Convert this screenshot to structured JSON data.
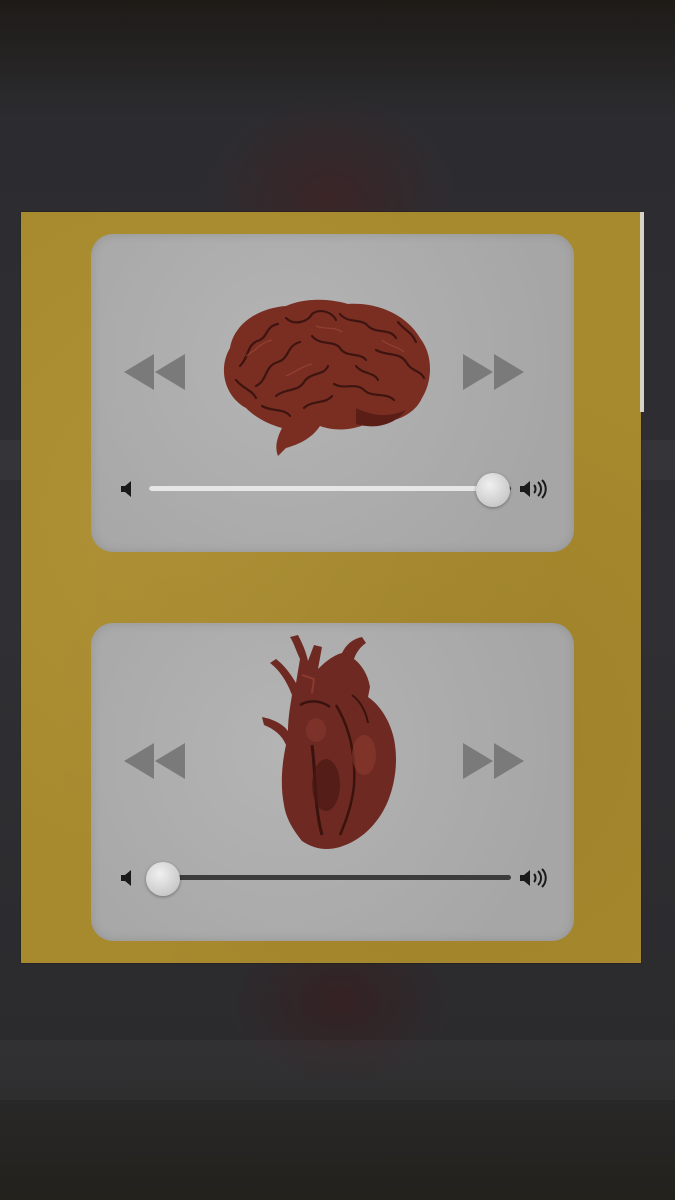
{
  "players": [
    {
      "id": "brain",
      "artwork": "brain-icon",
      "controls": {
        "previous": "rewind-icon",
        "next": "fast-forward-icon",
        "volume_low": "speaker-low-icon",
        "volume_high": "speaker-high-icon"
      },
      "volume": 0.95
    },
    {
      "id": "heart",
      "artwork": "heart-icon",
      "controls": {
        "previous": "rewind-icon",
        "next": "fast-forward-icon",
        "volume_low": "speaker-low-icon",
        "volume_high": "speaker-high-icon"
      },
      "volume": 0.04
    }
  ],
  "colors": {
    "poster_background": "#a88a2e",
    "player_panel": "#b0b0b0",
    "organ": "#7a2e22",
    "control_icon": "#7a7a7a"
  }
}
